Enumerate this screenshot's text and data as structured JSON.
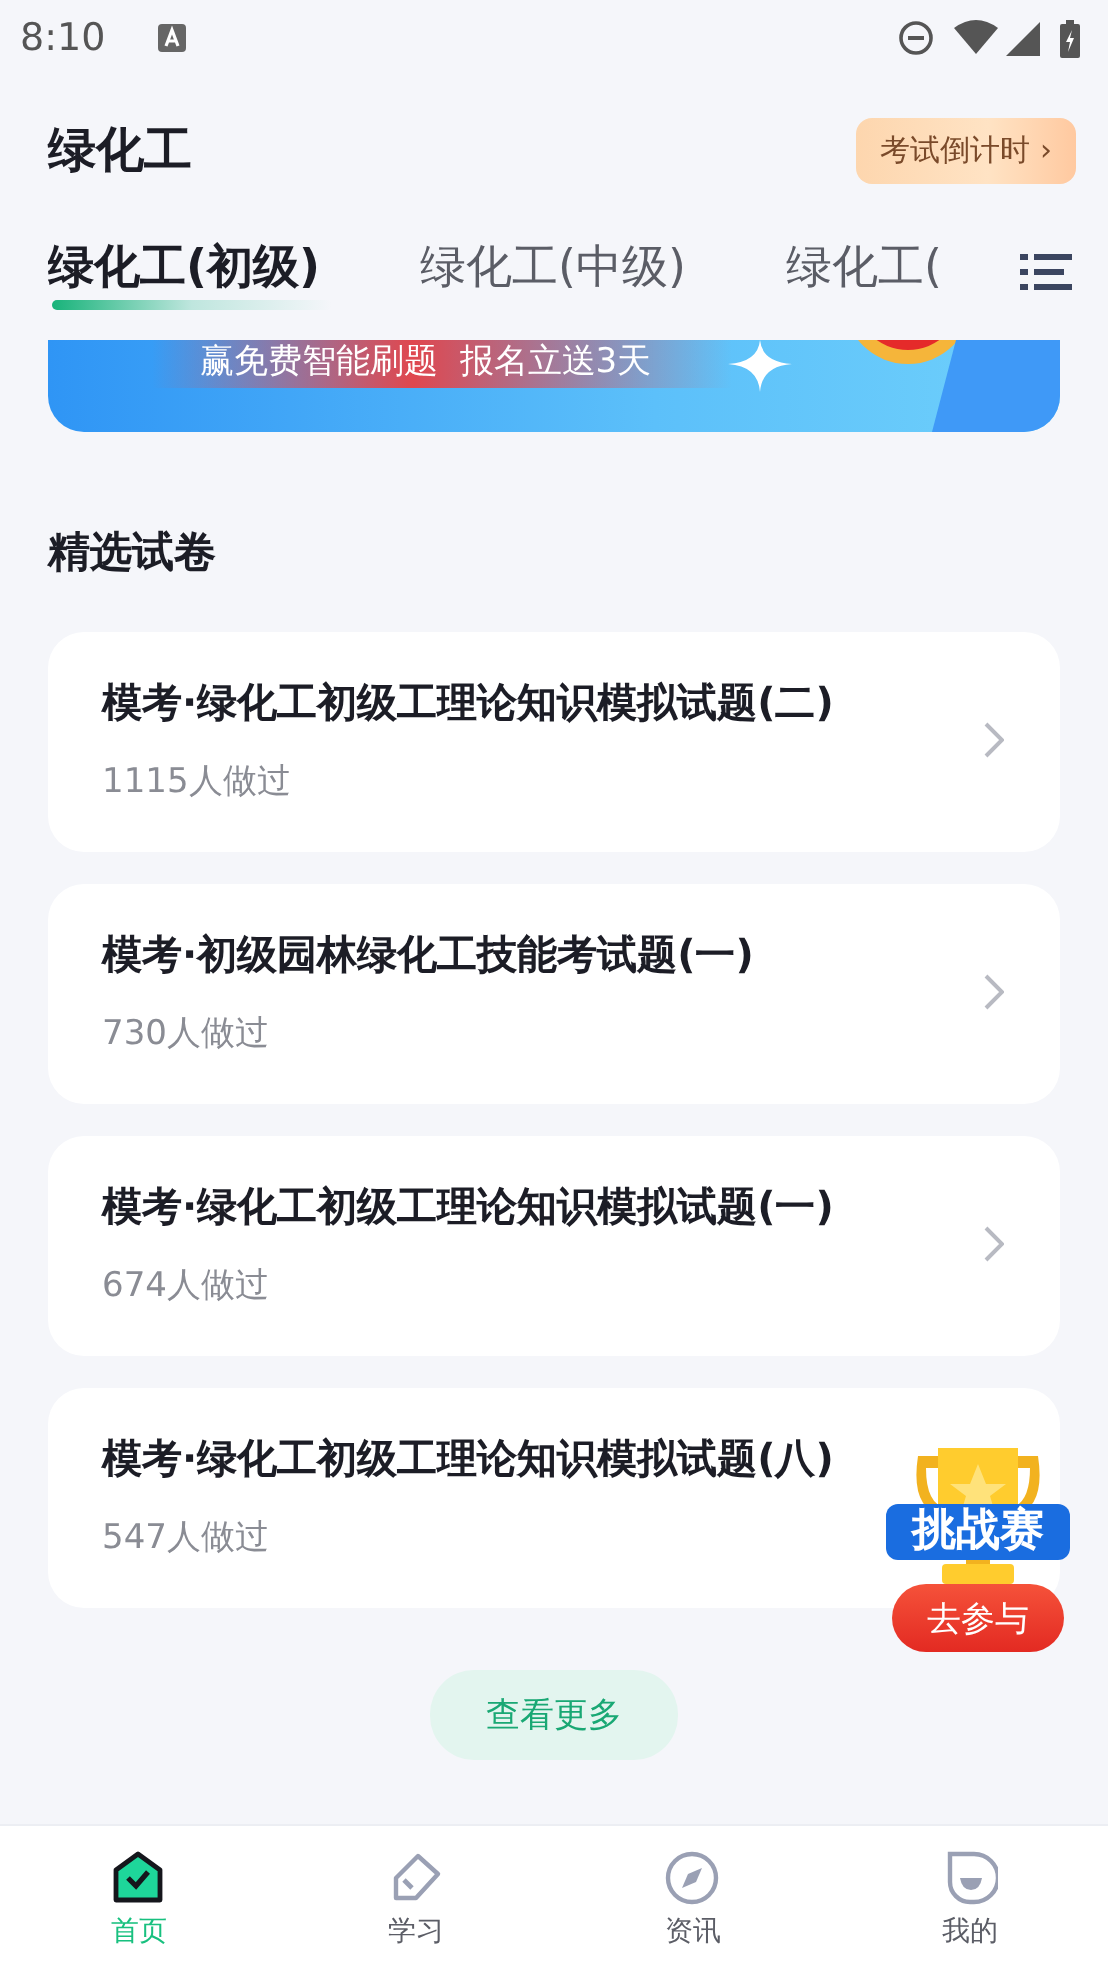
{
  "status_bar": {
    "time": "8:10"
  },
  "header": {
    "title": "绿化工",
    "countdown_button": "考试倒计时 ›"
  },
  "tabs": [
    {
      "label": "绿化工(初级)",
      "selected": true
    },
    {
      "label": "绿化工(中级)",
      "selected": false
    },
    {
      "label": "绿化工(",
      "selected": false
    }
  ],
  "banner": {
    "text": "赢免费智能刷题  报名立送3天"
  },
  "section": {
    "title": "精选试卷"
  },
  "papers": [
    {
      "title": "模考·绿化工初级工理论知识模拟试题(二)",
      "count": "1115人做过"
    },
    {
      "title": "模考·初级园林绿化工技能考试题(一)",
      "count": "730人做过"
    },
    {
      "title": "模考·绿化工初级工理论知识模拟试题(一)",
      "count": "674人做过"
    },
    {
      "title": "模考·绿化工初级工理论知识模拟试题(八)",
      "count": "547人做过"
    }
  ],
  "more_button": "查看更多",
  "challenge": {
    "title": "挑战赛",
    "button": "去参与"
  },
  "nav": [
    {
      "label": "首页",
      "selected": true
    },
    {
      "label": "学习",
      "selected": false
    },
    {
      "label": "资讯",
      "selected": false
    },
    {
      "label": "我的",
      "selected": false
    }
  ]
}
